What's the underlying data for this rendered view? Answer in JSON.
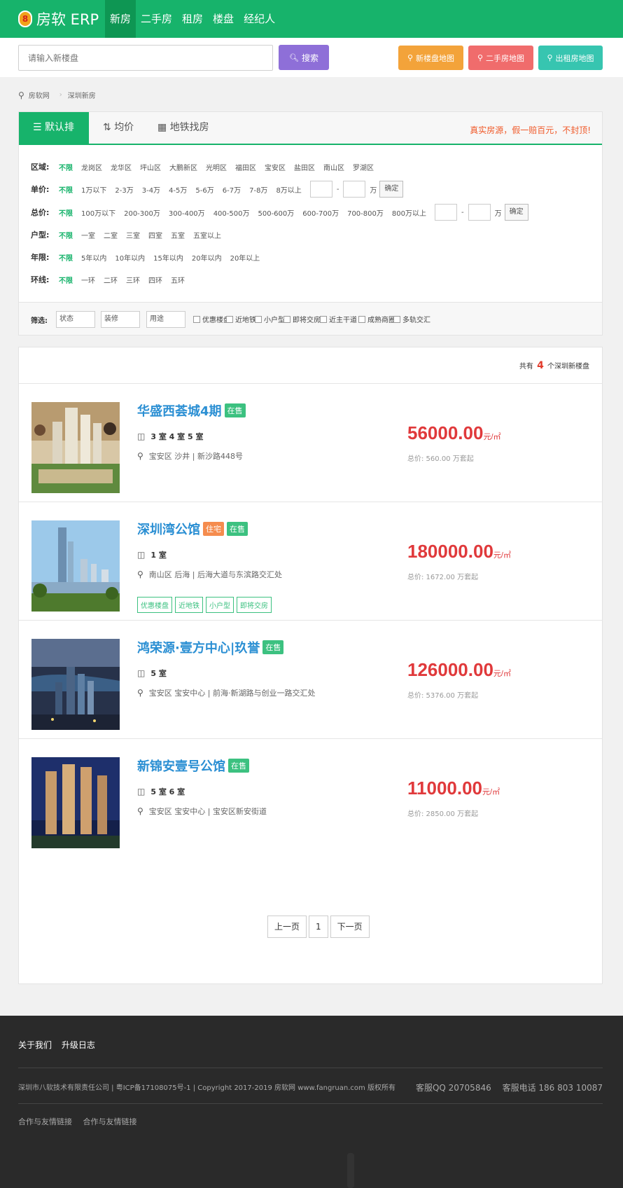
{
  "app": {
    "logo_glyph": "8",
    "title": "房软 ERP"
  },
  "nav": [
    {
      "label": "新房",
      "active": true
    },
    {
      "label": "二手房",
      "active": false
    },
    {
      "label": "租房",
      "active": false
    },
    {
      "label": "楼盘",
      "active": false
    },
    {
      "label": "经纪人",
      "active": false
    }
  ],
  "search": {
    "placeholder": "请输入新楼盘",
    "button_label": "搜索"
  },
  "map_buttons": [
    {
      "label": "新楼盘地图",
      "color": "#f3a33a"
    },
    {
      "label": "二手房地图",
      "color": "#f06c6c"
    },
    {
      "label": "出租房地图",
      "color": "#37c5b0"
    }
  ],
  "breadcrumb": {
    "home": "房软网",
    "current": "深圳新房"
  },
  "sort_tabs": [
    "默认排序",
    "均价",
    "地铁找房"
  ],
  "slogan": "真实房源，假一赔百元，不封顶!",
  "filters": {
    "district": {
      "label": "区域:",
      "options": [
        "不限",
        "龙岗区",
        "龙华区",
        "坪山区",
        "大鹏新区",
        "光明区",
        "福田区",
        "宝安区",
        "盐田区",
        "南山区",
        "罗湖区"
      ]
    },
    "unit_price": {
      "label": "单价:",
      "options": [
        "不限",
        "1万以下",
        "2-3万",
        "3-4万",
        "4-5万",
        "5-6万",
        "6-7万",
        "7-8万",
        "8万以上"
      ],
      "unit": "万",
      "confirm": "确定",
      "dash": "-"
    },
    "total_price": {
      "label": "总价:",
      "options": [
        "不限",
        "100万以下",
        "200-300万",
        "300-400万",
        "400-500万",
        "500-600万",
        "600-700万",
        "700-800万",
        "800万以上"
      ],
      "unit": "万",
      "confirm": "确定",
      "dash": "-"
    },
    "layout": {
      "label": "户型:",
      "options": [
        "不限",
        "一室",
        "二室",
        "三室",
        "四室",
        "五室",
        "五室以上"
      ]
    },
    "age": {
      "label": "年限:",
      "options": [
        "不限",
        "5年以内",
        "10年以内",
        "15年以内",
        "20年以内",
        "20年以上"
      ]
    },
    "ring": {
      "label": "环线:",
      "options": [
        "不限",
        "一环",
        "二环",
        "三环",
        "四环",
        "五环"
      ]
    }
  },
  "screen": {
    "label": "筛选:",
    "selects": [
      "状态",
      "装修",
      "用途"
    ],
    "checkboxes": [
      "优惠楼盘",
      "近地铁",
      "小户型",
      "即将交房",
      "近主干道",
      "成熟商圈",
      "多轨交汇"
    ]
  },
  "result_count": {
    "prefix": "共有",
    "count": "4",
    "suffix": "个深圳新楼盘"
  },
  "listings": [
    {
      "name": "华盛西荟城4期",
      "tags": [
        "在售"
      ],
      "rooms": "3 室 4 室 5 室",
      "address": "宝安区 沙井 | 新沙路448号",
      "features": [],
      "price": "56000.00",
      "price_unit": "元/㎡",
      "total": "总价: 560.00 万套起"
    },
    {
      "name": "深圳湾公馆",
      "tags": [
        "住宅",
        "在售"
      ],
      "rooms": "1 室",
      "address": "南山区 后海 | 后海大道与东滨路交汇处",
      "features": [
        "优惠楼盘",
        "近地铁",
        "小户型",
        "即将交房"
      ],
      "price": "180000.00",
      "price_unit": "元/㎡",
      "total": "总价: 1672.00 万套起"
    },
    {
      "name": "鸿荣源·壹方中心|玖誉",
      "tags": [
        "在售"
      ],
      "rooms": "5 室",
      "address": "宝安区 宝安中心 | 前海·新湖路与创业一路交汇处",
      "features": [],
      "price": "126000.00",
      "price_unit": "元/㎡",
      "total": "总价: 5376.00 万套起"
    },
    {
      "name": "新锦安壹号公馆",
      "tags": [
        "在售"
      ],
      "rooms": "5 室 6 室",
      "address": "宝安区 宝安中心 | 宝安区新安街道",
      "features": [],
      "price": "11000.00",
      "price_unit": "元/㎡",
      "total": "总价: 2850.00 万套起"
    }
  ],
  "pagination": {
    "prev": "上一页",
    "current": "1",
    "next": "下一页"
  },
  "footer": {
    "links": [
      "关于我们",
      "升级日志"
    ],
    "copyright": "深圳市八软技术有限责任公司 | 粤ICP备17108075号-1 | Copyright 2017-2019 房软网 www.fangruan.com 版权所有",
    "qq": "客服QQ 20705846",
    "phone": "客服电话 186 803 10087",
    "partners": [
      "合作与友情链接",
      "合作与友情链接"
    ]
  }
}
